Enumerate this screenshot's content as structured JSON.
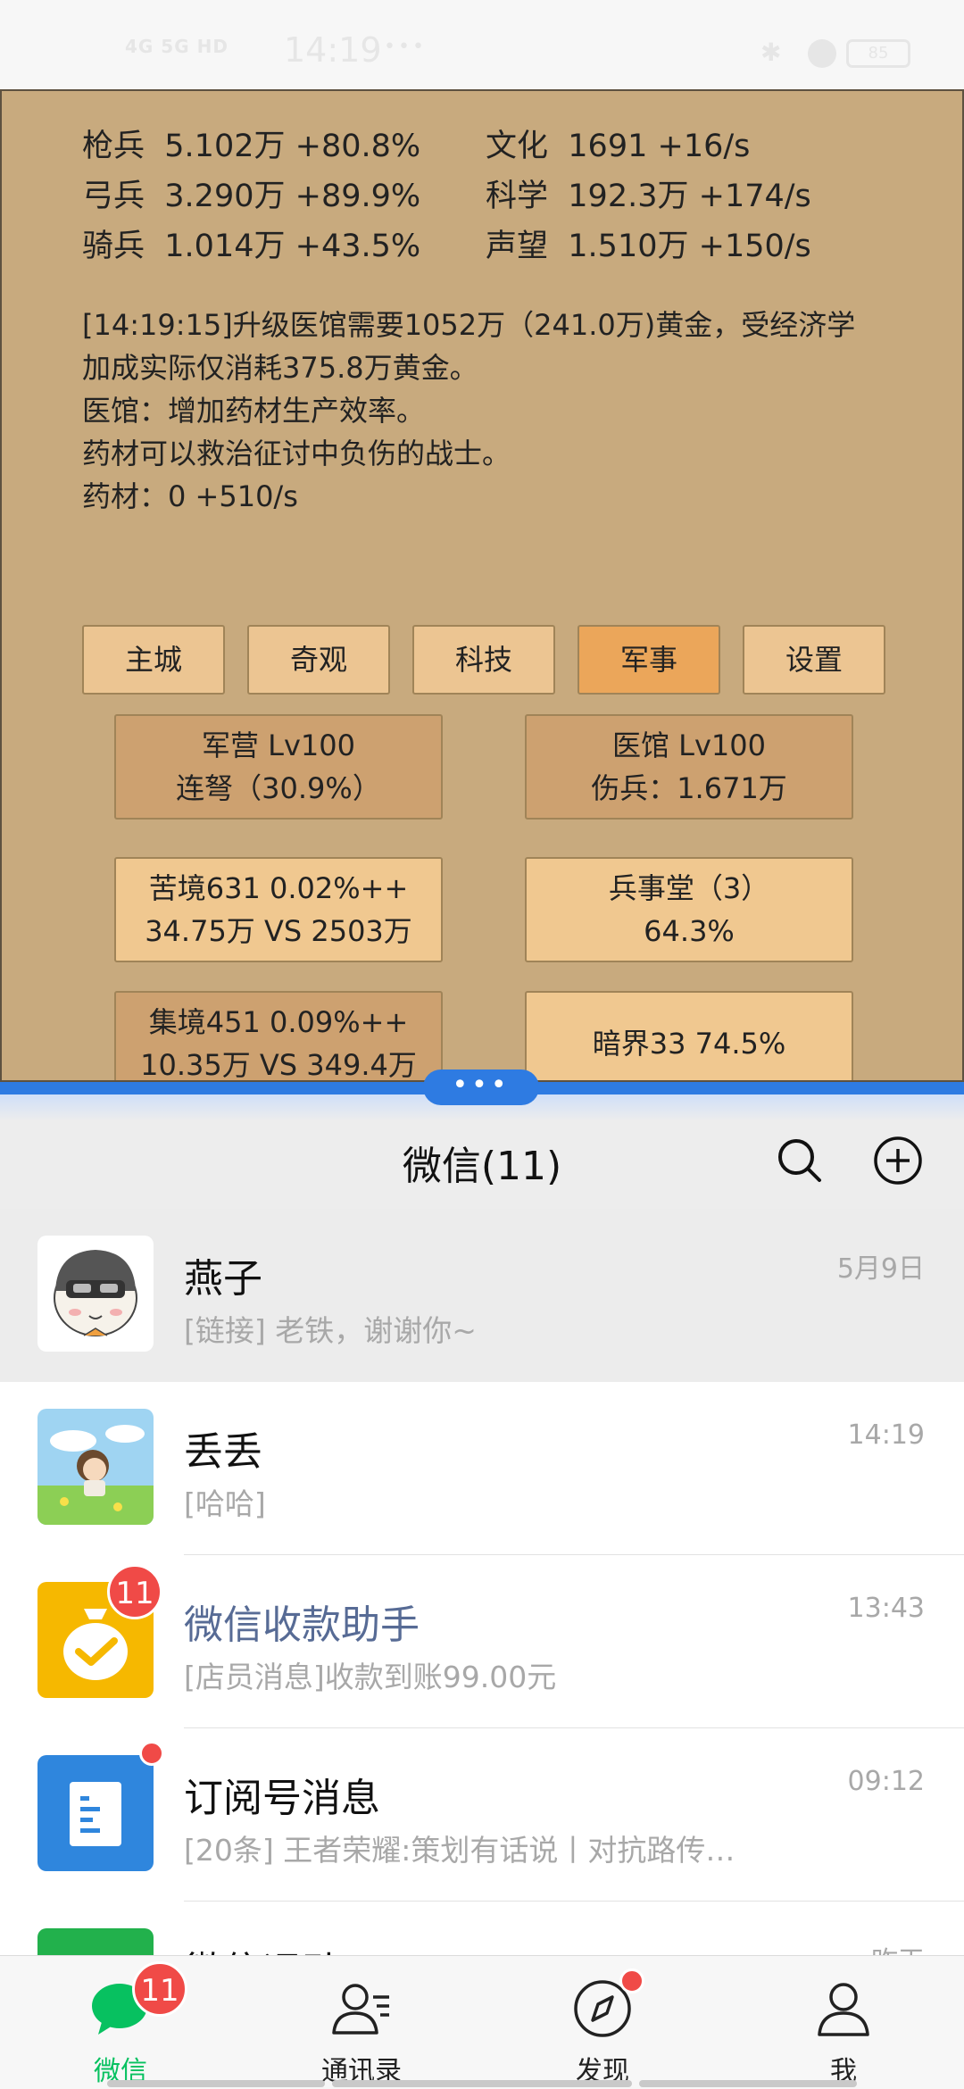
{
  "status_bar": {
    "time": "14:19",
    "signal": "4G 5G HD",
    "dots": "•••",
    "battery": "85"
  },
  "game": {
    "stats_left": [
      {
        "name": "枪兵",
        "value": "5.102万",
        "rate": "+80.8%"
      },
      {
        "name": "弓兵",
        "value": "3.290万",
        "rate": "+89.9%"
      },
      {
        "name": "骑兵",
        "value": "1.014万",
        "rate": "+43.5%"
      }
    ],
    "stats_right": [
      {
        "name": "文化",
        "value": "1691",
        "rate": "+16/s"
      },
      {
        "name": "科学",
        "value": "192.3万",
        "rate": "+174/s"
      },
      {
        "name": "声望",
        "value": "1.510万",
        "rate": "+150/s"
      }
    ],
    "log_lines": [
      "[14:19:15]升级医馆需要1052万（241.0万)黄金，受经济学",
      "加成实际仅消耗375.8万黄金。",
      "医馆：增加药材生产效率。",
      "药材可以救治征讨中负伤的战士。",
      "药材：0 +510/s"
    ],
    "tabs": [
      "主城",
      "奇观",
      "科技",
      "军事",
      "设置"
    ],
    "active_tab": "军事",
    "cards": [
      {
        "line1": "军营 Lv100",
        "line2": "连弩（30.9%）"
      },
      {
        "line1": "医馆 Lv100",
        "line2": "伤兵：1.671万"
      },
      {
        "line1": "苦境631  0.02%++",
        "line2": "34.75万 VS 2503万"
      },
      {
        "line1": "兵事堂（3）",
        "line2": "64.3%"
      },
      {
        "line1": "集境451  0.09%++",
        "line2": "10.35万 VS 349.4万"
      },
      {
        "line1": "暗界33  74.5%",
        "line2": ""
      }
    ]
  },
  "divider": {
    "handle": "•••"
  },
  "wechat": {
    "title": "微信(11)",
    "chats": [
      {
        "name": "燕子",
        "preview": "[链接] 老铁，谢谢你~",
        "time": "5月9日"
      },
      {
        "name": "丢丢",
        "preview": "[哈哈]",
        "time": "14:19"
      },
      {
        "name": "微信收款助手",
        "preview": "[店员消息]收款到账99.00元",
        "time": "13:43",
        "badge": "11"
      },
      {
        "name": "订阅号消息",
        "preview": "[20条] 王者荣耀:策划有话说丨对抗路传…",
        "time": "09:12"
      },
      {
        "name": "微信运动",
        "preview": "",
        "time": "昨天"
      }
    ],
    "nav": [
      {
        "label": "微信",
        "badge": "11"
      },
      {
        "label": "通讯录"
      },
      {
        "label": "发现"
      },
      {
        "label": "我"
      }
    ],
    "colors": {
      "accent": "#07c160",
      "badge": "#f04a47",
      "link_blue": "#576b95"
    }
  }
}
